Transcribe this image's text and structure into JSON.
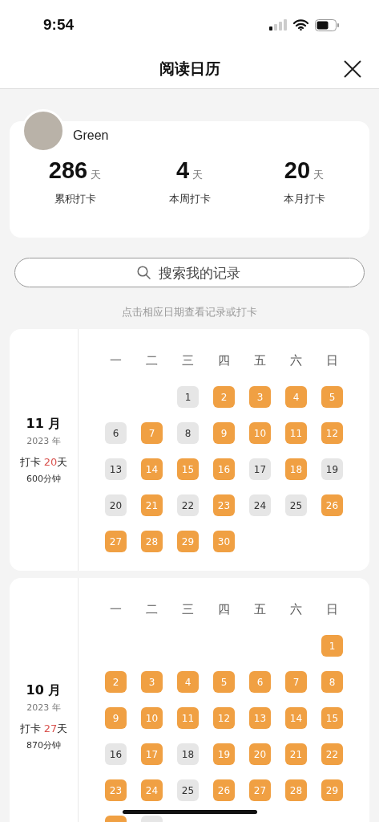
{
  "status_bar": {
    "time": "9:54"
  },
  "header": {
    "title": "阅读日历"
  },
  "profile": {
    "name": "Green",
    "stats": [
      {
        "value": "286",
        "unit": "天",
        "label": "累积打卡"
      },
      {
        "value": "4",
        "unit": "天",
        "label": "本周打卡"
      },
      {
        "value": "20",
        "unit": "天",
        "label": "本月打卡"
      }
    ]
  },
  "search": {
    "placeholder": "搜索我的记录"
  },
  "hint": "点击相应日期查看记录或打卡",
  "months": [
    {
      "month": "11 月",
      "year": "2023 年",
      "checkin_label": "打卡",
      "checkin_days": "20",
      "checkin_unit": "天",
      "minutes": "600分钟",
      "weekdays": [
        "一",
        "二",
        "三",
        "四",
        "五",
        "六",
        "日"
      ],
      "weeks": [
        [
          {
            "kind": "blank"
          },
          {
            "kind": "blank"
          },
          {
            "kind": "day",
            "day": "1",
            "done": false
          },
          {
            "kind": "day",
            "day": "2",
            "done": true
          },
          {
            "kind": "day",
            "day": "3",
            "done": true
          },
          {
            "kind": "day",
            "day": "4",
            "done": true
          },
          {
            "kind": "day",
            "day": "5",
            "done": true
          }
        ],
        [
          {
            "kind": "day",
            "day": "6",
            "done": false
          },
          {
            "kind": "day",
            "day": "7",
            "done": true
          },
          {
            "kind": "day",
            "day": "8",
            "done": false
          },
          {
            "kind": "day",
            "day": "9",
            "done": true
          },
          {
            "kind": "day",
            "day": "10",
            "done": true
          },
          {
            "kind": "day",
            "day": "11",
            "done": true
          },
          {
            "kind": "day",
            "day": "12",
            "done": true
          }
        ],
        [
          {
            "kind": "day",
            "day": "13",
            "done": false
          },
          {
            "kind": "day",
            "day": "14",
            "done": true
          },
          {
            "kind": "day",
            "day": "15",
            "done": true
          },
          {
            "kind": "day",
            "day": "16",
            "done": true
          },
          {
            "kind": "day",
            "day": "17",
            "done": false
          },
          {
            "kind": "day",
            "day": "18",
            "done": true
          },
          {
            "kind": "day",
            "day": "19",
            "done": false
          }
        ],
        [
          {
            "kind": "day",
            "day": "20",
            "done": false
          },
          {
            "kind": "day",
            "day": "21",
            "done": true
          },
          {
            "kind": "day",
            "day": "22",
            "done": false
          },
          {
            "kind": "day",
            "day": "23",
            "done": true
          },
          {
            "kind": "day",
            "day": "24",
            "done": false
          },
          {
            "kind": "day",
            "day": "25",
            "done": false
          },
          {
            "kind": "day",
            "day": "26",
            "done": true
          }
        ],
        [
          {
            "kind": "day",
            "day": "27",
            "done": true
          },
          {
            "kind": "day",
            "day": "28",
            "done": true
          },
          {
            "kind": "day",
            "day": "29",
            "done": true
          },
          {
            "kind": "day",
            "day": "30",
            "done": true
          }
        ]
      ]
    },
    {
      "month": "10 月",
      "year": "2023 年",
      "checkin_label": "打卡",
      "checkin_days": "27",
      "checkin_unit": "天",
      "minutes": "870分钟",
      "weekdays": [
        "一",
        "二",
        "三",
        "四",
        "五",
        "六",
        "日"
      ],
      "weeks": [
        [
          {
            "kind": "blank"
          },
          {
            "kind": "blank"
          },
          {
            "kind": "blank"
          },
          {
            "kind": "blank"
          },
          {
            "kind": "blank"
          },
          {
            "kind": "blank"
          },
          {
            "kind": "day",
            "day": "1",
            "done": true
          }
        ],
        [
          {
            "kind": "day",
            "day": "2",
            "done": true
          },
          {
            "kind": "day",
            "day": "3",
            "done": true
          },
          {
            "kind": "day",
            "day": "4",
            "done": true
          },
          {
            "kind": "day",
            "day": "5",
            "done": true
          },
          {
            "kind": "day",
            "day": "6",
            "done": true
          },
          {
            "kind": "day",
            "day": "7",
            "done": true
          },
          {
            "kind": "day",
            "day": "8",
            "done": true
          }
        ],
        [
          {
            "kind": "day",
            "day": "9",
            "done": true
          },
          {
            "kind": "day",
            "day": "10",
            "done": true
          },
          {
            "kind": "day",
            "day": "11",
            "done": true
          },
          {
            "kind": "day",
            "day": "12",
            "done": true
          },
          {
            "kind": "day",
            "day": "13",
            "done": true
          },
          {
            "kind": "day",
            "day": "14",
            "done": true
          },
          {
            "kind": "day",
            "day": "15",
            "done": true
          }
        ],
        [
          {
            "kind": "day",
            "day": "16",
            "done": false
          },
          {
            "kind": "day",
            "day": "17",
            "done": true
          },
          {
            "kind": "day",
            "day": "18",
            "done": false
          },
          {
            "kind": "day",
            "day": "19",
            "done": true
          },
          {
            "kind": "day",
            "day": "20",
            "done": true
          },
          {
            "kind": "day",
            "day": "21",
            "done": true
          },
          {
            "kind": "day",
            "day": "22",
            "done": true
          }
        ],
        [
          {
            "kind": "day",
            "day": "23",
            "done": true
          },
          {
            "kind": "day",
            "day": "24",
            "done": true
          },
          {
            "kind": "day",
            "day": "25",
            "done": false
          },
          {
            "kind": "day",
            "day": "26",
            "done": true
          },
          {
            "kind": "day",
            "day": "27",
            "done": true
          },
          {
            "kind": "day",
            "day": "28",
            "done": true
          },
          {
            "kind": "day",
            "day": "29",
            "done": true
          }
        ],
        [
          {
            "kind": "day",
            "done": true
          },
          {
            "kind": "day",
            "done": false
          }
        ]
      ]
    }
  ]
}
